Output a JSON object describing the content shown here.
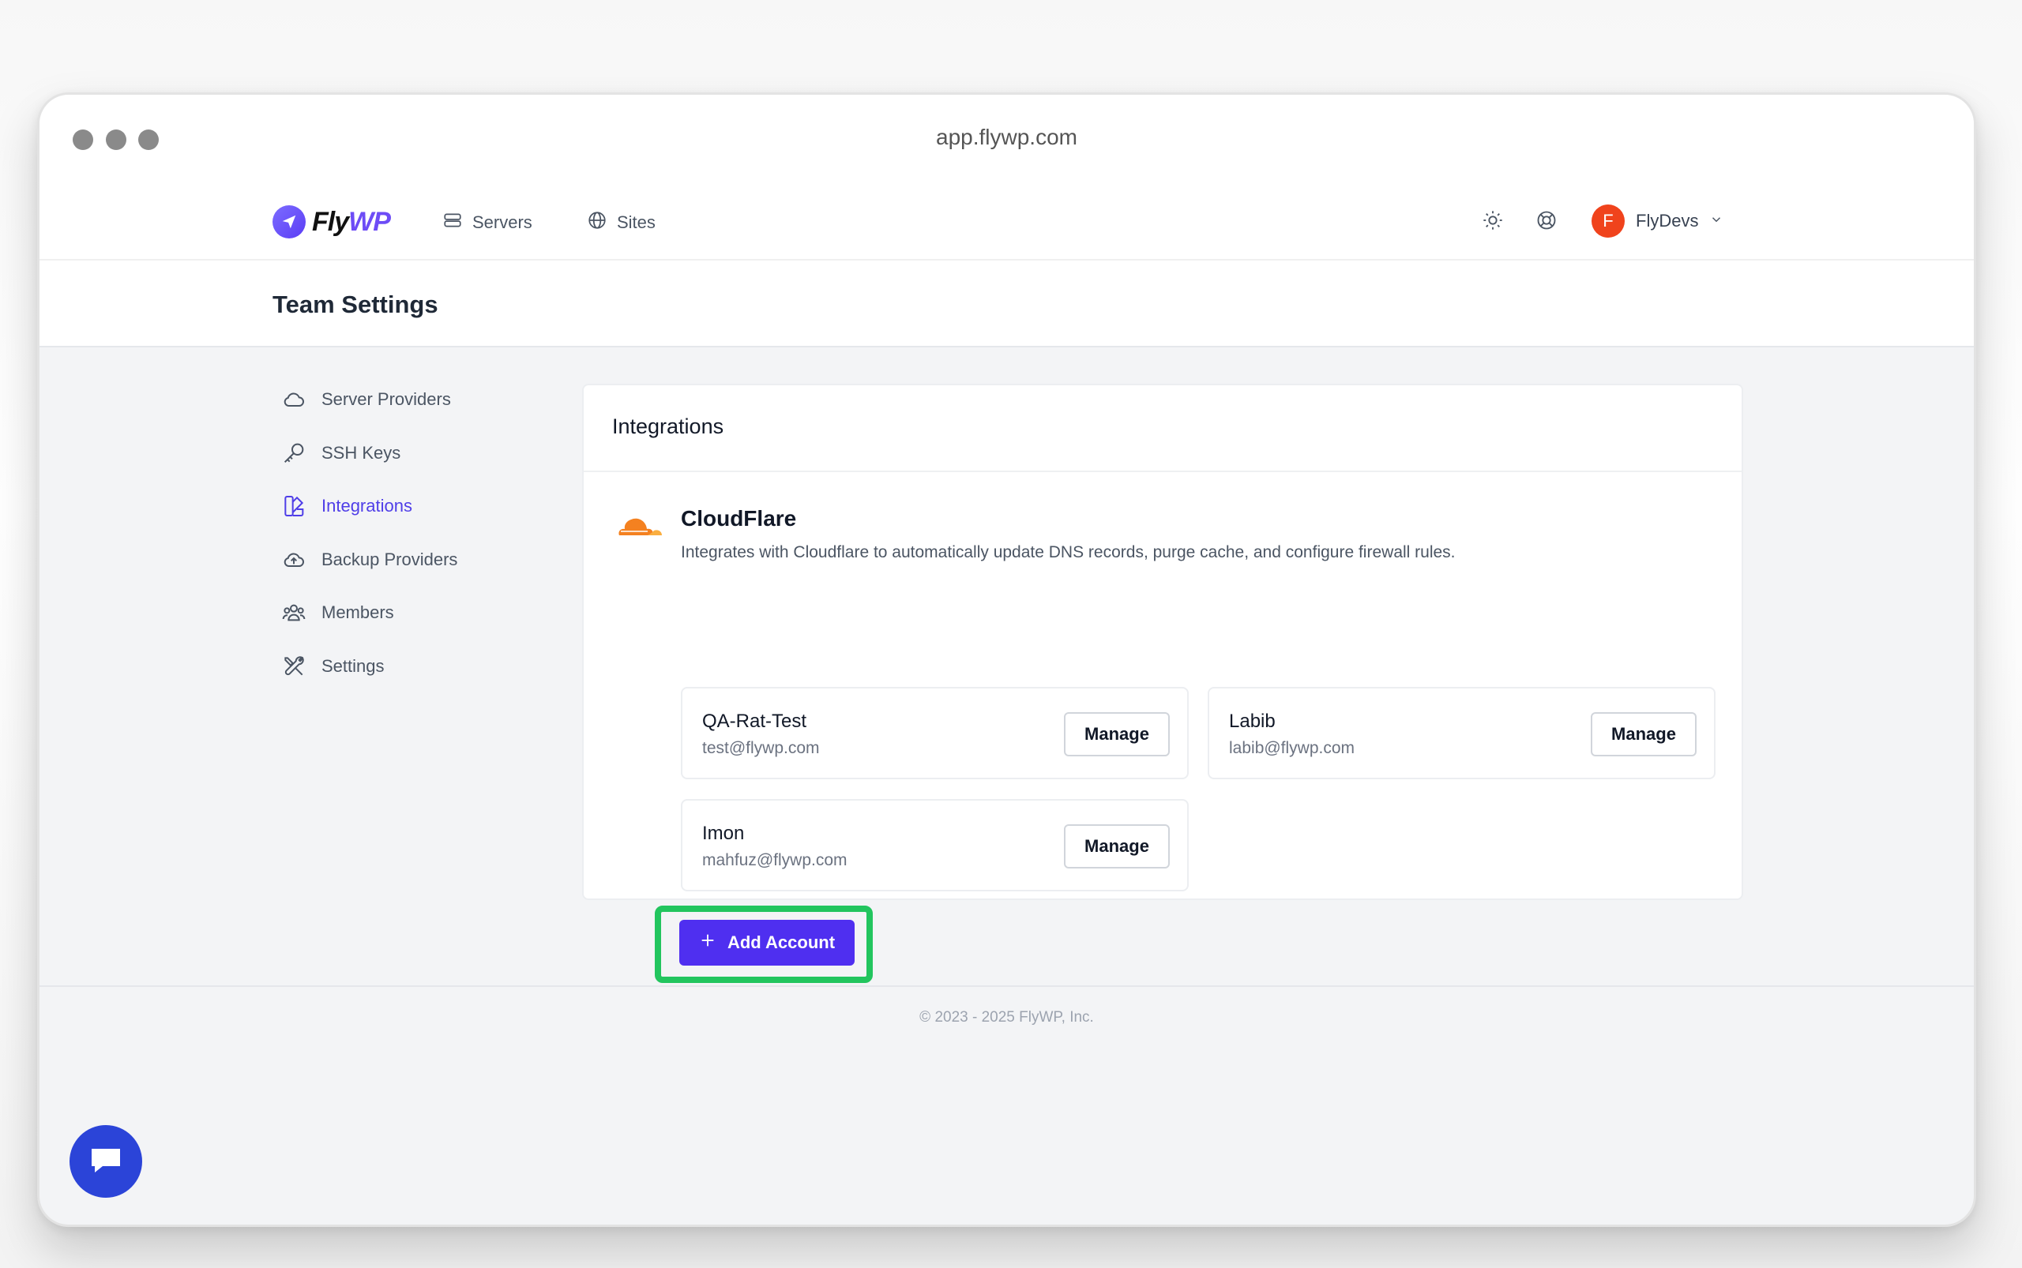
{
  "browser": {
    "url": "app.flywp.com"
  },
  "brand": {
    "name_prefix": "Fly",
    "name_suffix": "WP",
    "accent": "#6d4cf6"
  },
  "nav": {
    "servers": {
      "label": "Servers",
      "icon": "server-icon"
    },
    "sites": {
      "label": "Sites",
      "icon": "globe-icon"
    }
  },
  "user": {
    "initial": "F",
    "name": "FlyDevs",
    "avatar_color": "#f0431c"
  },
  "page": {
    "title": "Team Settings"
  },
  "sidebar": {
    "items": [
      {
        "label": "Server Providers",
        "icon": "cloud-icon",
        "active": false
      },
      {
        "label": "SSH Keys",
        "icon": "key-icon",
        "active": false
      },
      {
        "label": "Integrations",
        "icon": "integrations-icon",
        "active": true
      },
      {
        "label": "Backup Providers",
        "icon": "cloud-upload-icon",
        "active": false
      },
      {
        "label": "Members",
        "icon": "users-icon",
        "active": false
      },
      {
        "label": "Settings",
        "icon": "tools-icon",
        "active": false
      }
    ]
  },
  "integrations": {
    "heading": "Integrations",
    "cloudflare": {
      "title": "CloudFlare",
      "description": "Integrates with Cloudflare to automatically update DNS records, purge cache, and configure firewall rules.",
      "accounts": [
        {
          "name": "QA-Rat-Test",
          "email": "test@flywp.com",
          "action": "Manage"
        },
        {
          "name": "Labib",
          "email": "labib@flywp.com",
          "action": "Manage"
        },
        {
          "name": "Imon",
          "email": "mahfuz@flywp.com",
          "action": "Manage"
        }
      ],
      "add_label": "Add Account"
    }
  },
  "footer": {
    "copyright": "© 2023 - 2025 FlyWP, Inc."
  },
  "colors": {
    "primary_button": "#4f2ff0",
    "highlight": "#22c55e",
    "chat": "#2b44d8"
  }
}
